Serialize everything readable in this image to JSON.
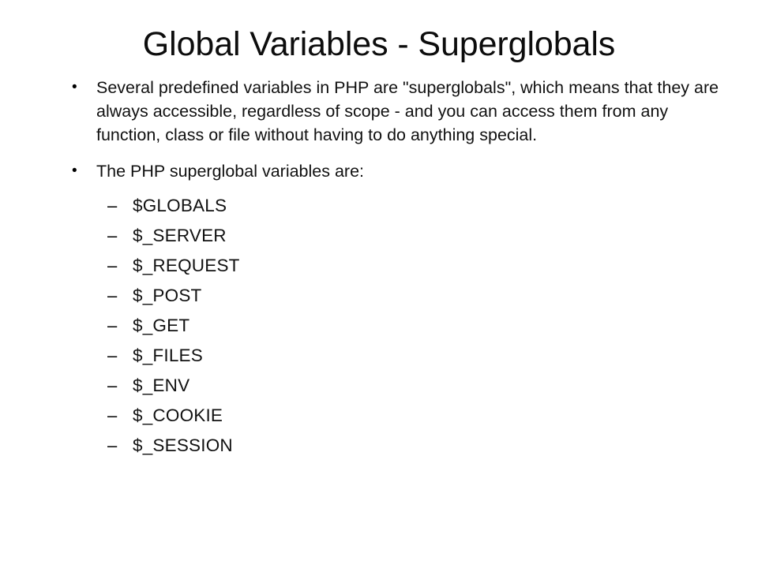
{
  "slide": {
    "background_color": "#ffffff",
    "text_color": "#111111",
    "title": "Global Variables - Superglobals",
    "bullets": [
      {
        "marker": "•",
        "text": "Several predefined variables in PHP are \"superglobals\", which means that they are always accessible, regardless of scope - and you can access them from any function, class or file without having to do anything special."
      },
      {
        "marker": "•",
        "text": "The PHP superglobal variables are:"
      }
    ],
    "subitems": [
      {
        "marker": "–",
        "text": "$GLOBALS"
      },
      {
        "marker": "–",
        "text": "$_SERVER"
      },
      {
        "marker": "–",
        "text": "$_REQUEST"
      },
      {
        "marker": "–",
        "text": "$_POST"
      },
      {
        "marker": "–",
        "text": "$_GET"
      },
      {
        "marker": "–",
        "text": "$_FILES"
      },
      {
        "marker": "–",
        "text": "$_ENV"
      },
      {
        "marker": "–",
        "text": "$_COOKIE"
      },
      {
        "marker": "–",
        "text": "$_SESSION"
      }
    ]
  }
}
